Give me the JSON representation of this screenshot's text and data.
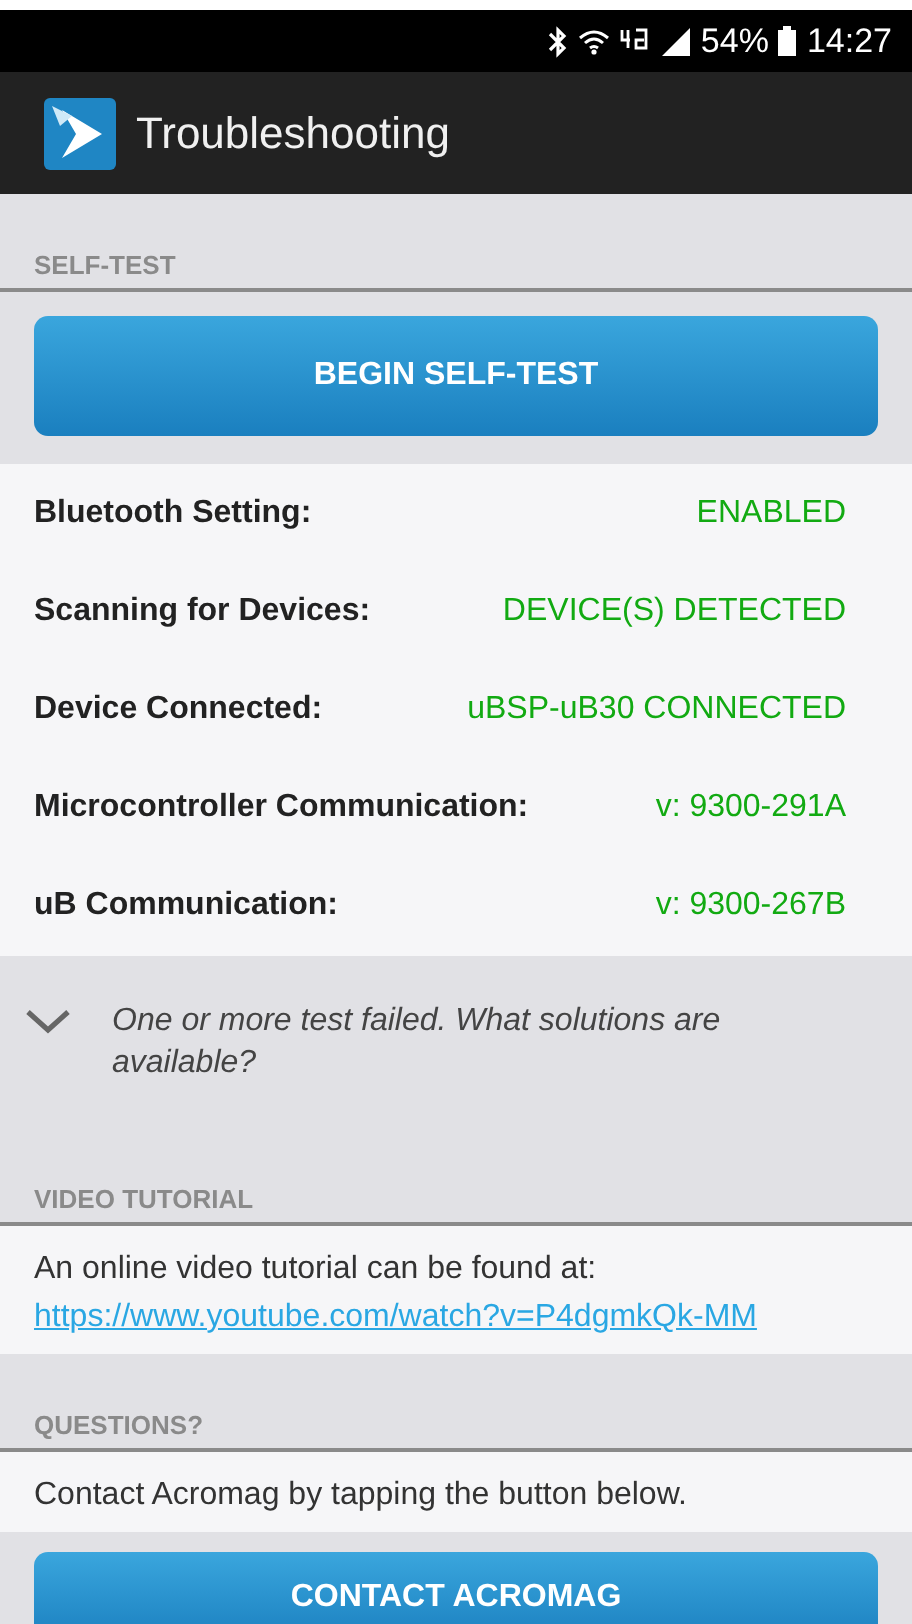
{
  "status_bar": {
    "battery": "54%",
    "time": "14:27"
  },
  "app_bar": {
    "title": "Troubleshooting"
  },
  "self_test": {
    "heading": "SELF-TEST",
    "button": "BEGIN SELF-TEST",
    "results": [
      {
        "label": "Bluetooth Setting:",
        "value": "ENABLED"
      },
      {
        "label": "Scanning for Devices:",
        "value": "DEVICE(S) DETECTED"
      },
      {
        "label": "Device Connected:",
        "value": "uBSP-uB30 CONNECTED"
      },
      {
        "label": "Microcontroller Communication:",
        "value": "v: 9300-291A"
      },
      {
        "label": "uB Communication:",
        "value": "v: 9300-267B"
      }
    ]
  },
  "solutions": {
    "text": "One or more test failed. What solutions are available?",
    "expanded": false
  },
  "video_tutorial": {
    "heading": "VIDEO TUTORIAL",
    "text": "An online video tutorial can be found at:",
    "link": "https://www.youtube.com/watch?v=P4dgmkQk-MM"
  },
  "questions": {
    "heading": "QUESTIONS?",
    "text": "Contact Acromag by tapping the button below.",
    "button": "CONTACT ACROMAG"
  }
}
